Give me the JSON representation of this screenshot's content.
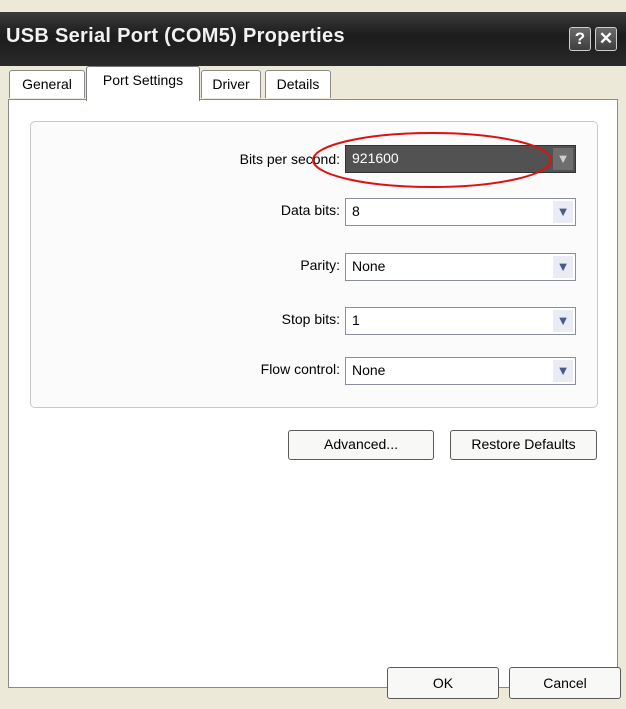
{
  "window": {
    "title": "USB Serial Port (COM5) Properties"
  },
  "titlebar": {
    "help_label": "?",
    "close_label": "✕"
  },
  "tabs": [
    {
      "label": "General",
      "active": false
    },
    {
      "label": "Port Settings",
      "active": true
    },
    {
      "label": "Driver",
      "active": false
    },
    {
      "label": "Details",
      "active": false
    }
  ],
  "port_settings": {
    "fields": [
      {
        "label": "Bits per second:",
        "value": "921600"
      },
      {
        "label": "Data bits:",
        "value": "8"
      },
      {
        "label": "Parity:",
        "value": "None"
      },
      {
        "label": "Stop bits:",
        "value": "1"
      },
      {
        "label": "Flow control:",
        "value": "None"
      }
    ],
    "advanced_label": "Advanced...",
    "restore_label": "Restore Defaults"
  },
  "footer": {
    "ok_label": "OK",
    "cancel_label": "Cancel"
  },
  "colors": {
    "highlight_ellipse": "#e01010",
    "selected_combo": "#525252"
  }
}
